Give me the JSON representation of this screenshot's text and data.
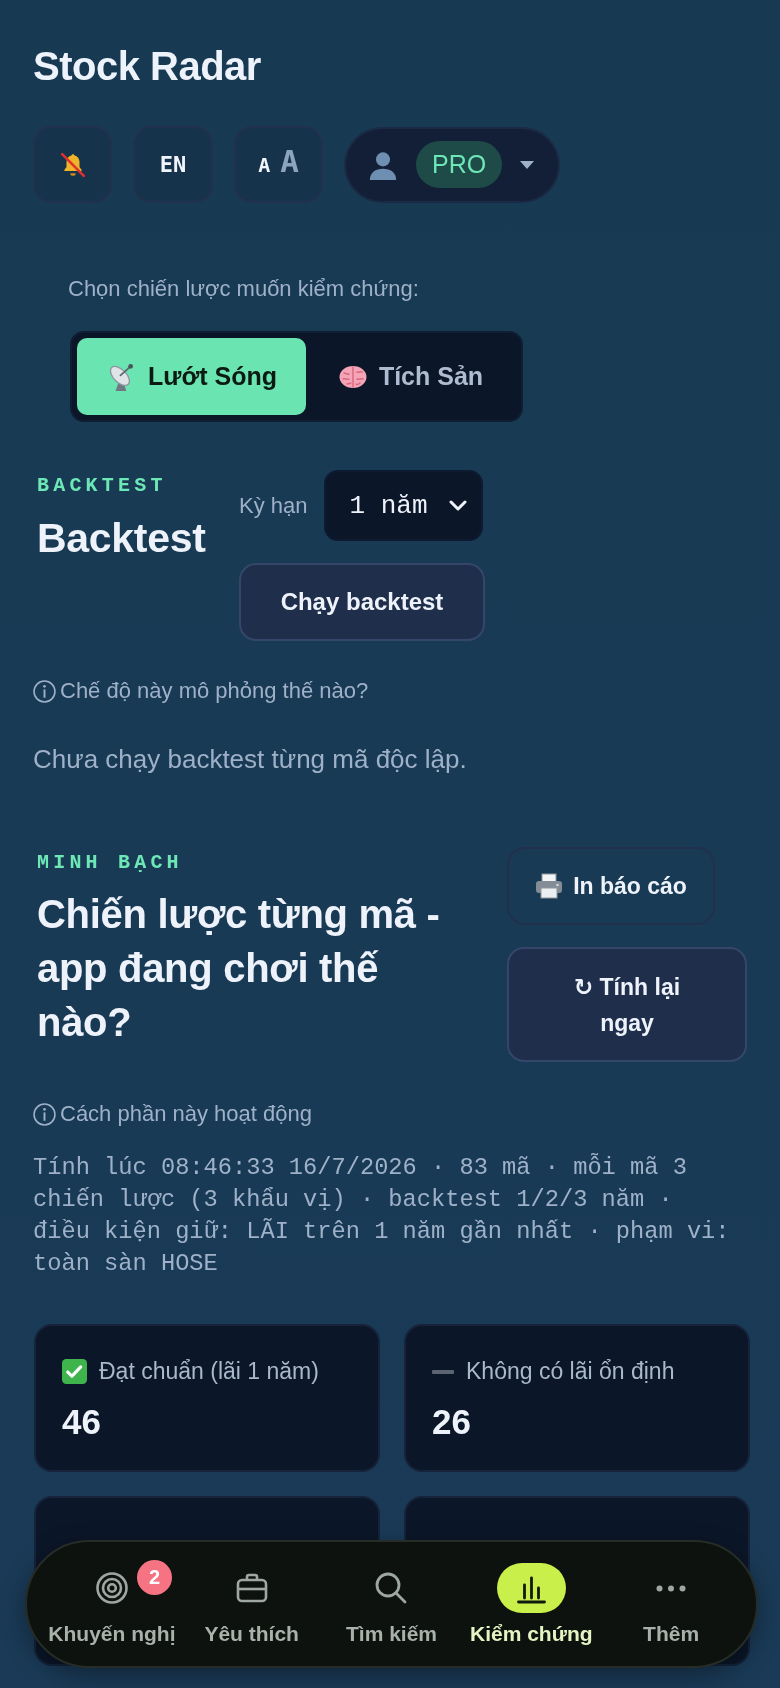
{
  "app": {
    "title": "Stock Radar"
  },
  "toolbar": {
    "notifications_muted": true,
    "language": "EN",
    "font_size": {
      "small": "A",
      "large": "A"
    },
    "profile": {
      "plan": "PRO"
    }
  },
  "strategy_picker": {
    "prompt": "Chọn chiến lược muốn kiểm chứng:",
    "options": [
      {
        "label": "Lướt Sóng",
        "kind": "satellite",
        "selected": true
      },
      {
        "label": "Tích Sản",
        "kind": "brain",
        "selected": false
      }
    ]
  },
  "backtest": {
    "eyebrow": "BACKTEST",
    "title": "Backtest",
    "period_label": "Kỳ hạn",
    "period_value": "1 năm",
    "run_button": "Chạy backtest",
    "help_link": "Chế độ này mô phỏng thế nào?",
    "status": "Chưa chạy backtest từng mã độc lập."
  },
  "transparency": {
    "eyebrow": "MINH BẠCH",
    "title": "Chiến lược từng mã - app đang chơi thế nào?",
    "print_button": "In báo cáo",
    "recalc_button": "↻ Tính lại ngay",
    "help_link": "Cách phần này hoạt động",
    "summary": "Tính lúc 08:46:33 16/7/2026 · 83 mã · mỗi mã 3 chiến lược (3 khẩu vị) · backtest 1/2/3 năm · điều kiện giữ: LÃI trên 1 năm gần nhất · phạm vi: toàn sàn HOSE",
    "stats": [
      {
        "kind": "check",
        "label": "Đạt chuẩn (lãi 1 năm)",
        "value": "46"
      },
      {
        "kind": "dash",
        "label": "Không có lãi ổn định",
        "value": "26"
      }
    ]
  },
  "bottom_nav": [
    {
      "label": "Khuyến nghị",
      "kind": "target",
      "badge": "2",
      "selected": false
    },
    {
      "label": "Yêu thích",
      "kind": "briefcase",
      "selected": false
    },
    {
      "label": "Tìm kiếm",
      "kind": "search",
      "selected": false
    },
    {
      "label": "Kiểm chứng",
      "kind": "chart",
      "selected": true
    },
    {
      "label": "Thêm",
      "kind": "more",
      "selected": false
    }
  ]
}
